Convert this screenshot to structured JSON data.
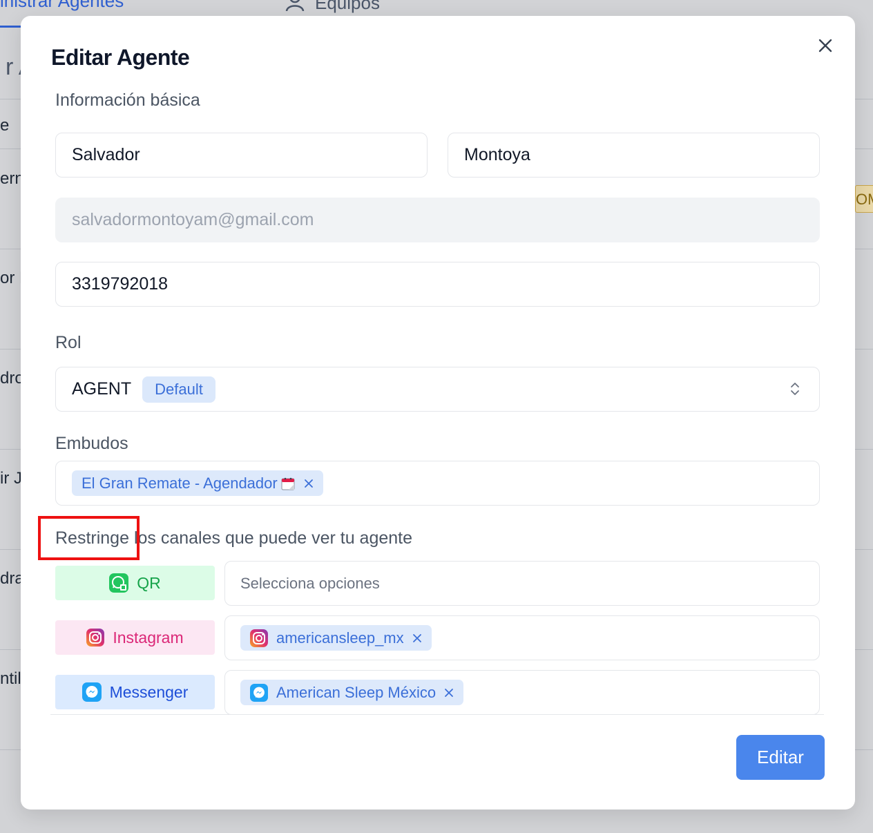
{
  "background": {
    "tabs": [
      {
        "label": "inistrar Agentes"
      },
      {
        "label": "Equipos"
      }
    ],
    "heading_fragment": "r A",
    "row_fragments": [
      "e",
      "ern",
      "or N",
      "dro",
      "ir Jo",
      "dra",
      "ntill"
    ],
    "badge_fragment": "OM"
  },
  "modal": {
    "title": "Editar Agente",
    "basic_info_label": "Información básica",
    "first_name": "Salvador",
    "last_name": "Montoya",
    "email": "salvadormontoyam@gmail.com",
    "phone": "3319792018",
    "role_label": "Rol",
    "role_value": "AGENT",
    "role_badge": "Default",
    "funnels_label": "Embudos",
    "funnel_chips": [
      "El Gran Remate - Agendador"
    ],
    "channels_label": "Restringe los canales que puede ver tu agente",
    "channels": [
      {
        "name": "QR",
        "icon": "whatsapp-qr-icon",
        "placeholder": "Selecciona opciones",
        "selected": []
      },
      {
        "name": "Instagram",
        "icon": "instagram-icon",
        "placeholder": "",
        "selected": [
          "americansleep_mx"
        ]
      },
      {
        "name": "Messenger",
        "icon": "messenger-icon",
        "placeholder": "",
        "selected": [
          "American Sleep México"
        ]
      }
    ],
    "submit_label": "Editar"
  },
  "colors": {
    "accent": "#4a86ec",
    "chip_bg": "#dde9fb",
    "chip_text": "#3b6fd8",
    "highlight": "#ee1111"
  }
}
